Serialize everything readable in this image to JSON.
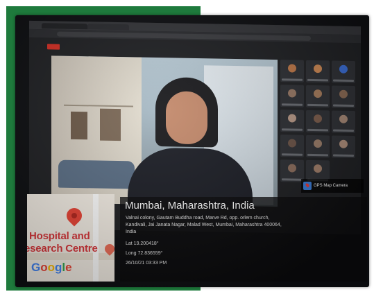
{
  "location": {
    "city": "Mumbai, Maharashtra, India",
    "address_line1": "Valnai colony, Gautam Buddha road, Marve Rd, opp. orlem church,",
    "address_line2": "Kandivali, Jai Janata Nagar, Malad West, Mumbai, Maharashtra 400064,",
    "address_line3": "India",
    "lat": "Lat 19.200418°",
    "long": "Long 72.836559°",
    "timestamp": "26/10/21 03:33 PM"
  },
  "gps_badge": {
    "label": "GPS Map Camera"
  },
  "map": {
    "place_line1": "Hospital and",
    "place_line2": "esearch Centre",
    "brand": "Google"
  },
  "colors": {
    "frame_green": "#1e7a3c",
    "pin_red": "#ea4335",
    "map_text_red": "#d9363a",
    "record_red": "#d93025"
  }
}
